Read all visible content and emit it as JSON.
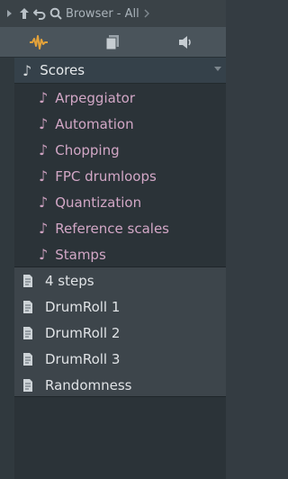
{
  "titlebar": {
    "title": "Browser - All"
  },
  "panel": {
    "root": {
      "label": "Scores"
    },
    "sub_items": [
      {
        "label": "Arpeggiator"
      },
      {
        "label": "Automation"
      },
      {
        "label": "Chopping"
      },
      {
        "label": "FPC drumloops"
      },
      {
        "label": "Quantization"
      },
      {
        "label": "Reference scales"
      },
      {
        "label": "Stamps"
      }
    ],
    "files": [
      {
        "label": "4 steps"
      },
      {
        "label": "DrumRoll 1"
      },
      {
        "label": "DrumRoll 2"
      },
      {
        "label": "DrumRoll 3"
      },
      {
        "label": "Randomness"
      }
    ]
  },
  "colors": {
    "accent": "#e3a23a",
    "sub_text": "#d2a7c6"
  }
}
